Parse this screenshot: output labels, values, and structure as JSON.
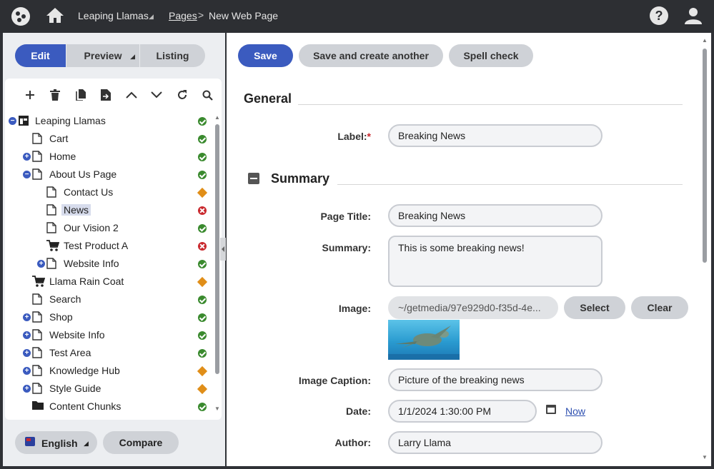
{
  "topbar": {
    "site_name": "Leaping Llamas",
    "breadcrumb_link": "Pages",
    "breadcrumb_sep": ">",
    "breadcrumb_current": "New Web Page",
    "help_label": "?"
  },
  "left_tabs": [
    {
      "label": "Edit",
      "active": true
    },
    {
      "label": "Preview",
      "active": false
    },
    {
      "label": "Listing",
      "active": false
    }
  ],
  "tree_tools": [
    "add-icon",
    "delete-icon",
    "copy-icon",
    "move-icon",
    "move-up-icon",
    "move-down-icon",
    "refresh-icon",
    "search-icon"
  ],
  "tree": [
    {
      "label": "Leaping Llamas",
      "icon": "site-icon",
      "expander": "minus",
      "status": "published"
    },
    {
      "label": "Cart",
      "icon": "page-icon",
      "status": "published"
    },
    {
      "label": "Home",
      "icon": "page-icon",
      "expander": "plus",
      "status": "published"
    },
    {
      "label": "About Us Page",
      "icon": "page-icon",
      "expander": "minus",
      "status": "published"
    },
    {
      "label": "Contact Us",
      "icon": "page-icon",
      "status": "draft"
    },
    {
      "label": "News",
      "icon": "page-icon",
      "status": "error",
      "selected": true
    },
    {
      "label": "Our Vision 2",
      "icon": "page-icon",
      "status": "published"
    },
    {
      "label": "Test Product A",
      "icon": "cart-icon",
      "status": "error"
    },
    {
      "label": "Website Info",
      "icon": "page-icon",
      "expander": "plus",
      "status": "published"
    },
    {
      "label": "Llama Rain Coat",
      "icon": "cart-icon",
      "status": "draft"
    },
    {
      "label": "Search",
      "icon": "page-icon",
      "status": "published"
    },
    {
      "label": "Shop",
      "icon": "page-icon",
      "expander": "plus",
      "status": "published"
    },
    {
      "label": "Website Info",
      "icon": "page-icon",
      "expander": "plus",
      "status": "published"
    },
    {
      "label": "Test Area",
      "icon": "page-icon",
      "expander": "plus",
      "status": "published"
    },
    {
      "label": "Knowledge Hub",
      "icon": "page-icon",
      "expander": "plus",
      "status": "draft"
    },
    {
      "label": "Style Guide",
      "icon": "page-icon",
      "expander": "plus",
      "status": "draft"
    },
    {
      "label": "Content Chunks",
      "icon": "folder-icon",
      "status": "published"
    }
  ],
  "bottom": {
    "language": "English",
    "compare": "Compare"
  },
  "actions": {
    "save": "Save",
    "save_another": "Save and create another",
    "spell_check": "Spell check"
  },
  "sections": {
    "general": "General",
    "summary": "Summary"
  },
  "fields": {
    "label_label": "Label:",
    "label_required": "*",
    "label_value": "Breaking News",
    "page_title_label": "Page Title:",
    "page_title_value": "Breaking News",
    "summary_label": "Summary:",
    "summary_value": "This is some breaking news!",
    "image_label": "Image:",
    "image_path": "~/getmedia/97e929d0-f35d-4e...",
    "image_select": "Select",
    "image_clear": "Clear",
    "caption_label": "Image Caption:",
    "caption_value": "Picture of the breaking news",
    "date_label": "Date:",
    "date_value": "1/1/2024 1:30:00 PM",
    "date_now": "Now",
    "author_label": "Author:",
    "author_value": "Larry Llama"
  },
  "colors": {
    "primary": "#3b5bbf",
    "published": "#3a8a2e",
    "draft": "#e08e18",
    "error": "#c9282d"
  }
}
